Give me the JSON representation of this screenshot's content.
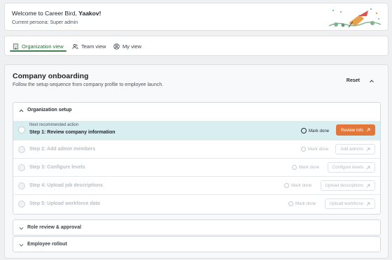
{
  "welcome": {
    "greeting": "Welcome to Career Bird, ",
    "name": "Yaakov!",
    "persona": "Current persona: Super admin"
  },
  "tabs": [
    {
      "label": "Organization view",
      "icon": "building-icon",
      "active": true
    },
    {
      "label": "Team view",
      "icon": "users-icon",
      "active": false
    },
    {
      "label": "My view",
      "icon": "user-circle-icon",
      "active": false
    }
  ],
  "onboarding": {
    "title": "Company onboarding",
    "subtitle": "Follow the setup sequence from company profile to employee launch.",
    "reset_label": "Reset",
    "sections": [
      {
        "label": "Organization setup",
        "expanded": true,
        "next_label": "Next recommended action",
        "steps": [
          {
            "title": "Step 1: Review company information",
            "mark": "Mark done",
            "action": "Review info",
            "recommended": true
          },
          {
            "title": "Step 2: Add admin members",
            "mark": "Mark done",
            "action": "Add admins",
            "recommended": false
          },
          {
            "title": "Step 3: Configure levels",
            "mark": "Mark done",
            "action": "Configure levels",
            "recommended": false
          },
          {
            "title": "Step 4: Upload job descriptions",
            "mark": "Mark done",
            "action": "Upload descriptions",
            "recommended": false
          },
          {
            "title": "Step 5: Upload workforce data",
            "mark": "Mark done",
            "action": "Upload workforce",
            "recommended": false
          }
        ]
      },
      {
        "label": "Role review & approval",
        "expanded": false
      },
      {
        "label": "Employee rollout",
        "expanded": false
      }
    ]
  },
  "colors": {
    "accent_green": "#3f7f52",
    "cta_orange": "#e3773a",
    "highlight_row": "#d9eef1"
  }
}
